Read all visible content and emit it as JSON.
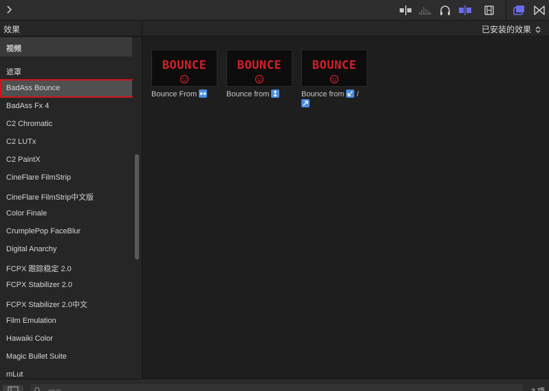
{
  "toolbar": {
    "icons": [
      "chevron-right-icon",
      "clip-skimming-icon",
      "audio-waveform-icon",
      "headphones-icon",
      "snapping-icon",
      "filmstrip-icon",
      "effects-browser-icon",
      "bowtie-icon"
    ],
    "accent": "#6a6cf0"
  },
  "left_pane": {
    "title": "效果",
    "category_header": "视频",
    "items": [
      "遮罩",
      "BadAss Bounce",
      "BadAss Fx 4",
      "C2 Chromatic",
      "C2 LUTx",
      "C2 PaintX",
      "CineFlare FilmStrip",
      "CineFlare FilmStrip中文版",
      "Color Finale",
      "CrumplePop FaceBlur",
      "Digital Anarchy",
      "FCPX 跟踪稳定 2.0",
      "FCPX Stabilizer 2.0",
      "FCPX Stabilizer 2.0中文",
      "Film Emulation",
      "Hawaiki Color",
      "Magic Bullet Suite",
      "mLut"
    ],
    "selected_item": "BadAss Bounce",
    "selection_outline_color": "#d0161b"
  },
  "right_pane": {
    "sort_label": "已安装的效果",
    "tiles": [
      {
        "thumb_text": "BOUNCE",
        "label": "Bounce From",
        "emoji": "left-right-arrow-icon",
        "label_suffix": ""
      },
      {
        "thumb_text": "BOUNCE",
        "label": "Bounce from",
        "emoji": "up-down-arrow-icon",
        "label_suffix": ""
      },
      {
        "thumb_text": "BOUNCE",
        "label": "Bounce from",
        "emoji": "down-left-arrow-icon",
        "label_suffix": " /",
        "emoji2": "up-right-arrow-icon"
      }
    ],
    "thumb_text_color": "#d51f2a"
  },
  "bottom": {
    "search_placeholder": "搜索",
    "count": "3 项"
  }
}
